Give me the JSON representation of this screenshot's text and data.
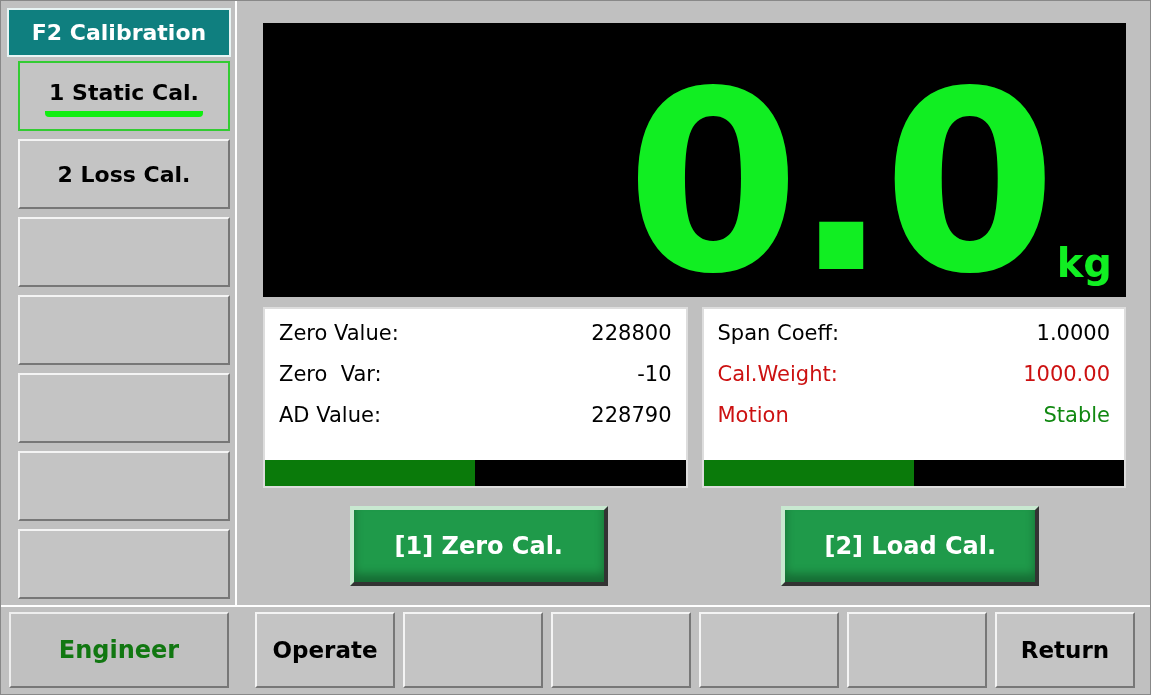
{
  "sidebar": {
    "title": "F2 Calibration",
    "items": [
      {
        "label": "1 Static Cal.",
        "selected": true
      },
      {
        "label": "2 Loss Cal.",
        "selected": false
      },
      {
        "selected": false
      },
      {
        "selected": false
      },
      {
        "selected": false
      },
      {
        "selected": false
      },
      {
        "selected": false
      }
    ]
  },
  "readout": {
    "value": "0.0",
    "unit": "kg"
  },
  "panels": [
    {
      "rows": [
        {
          "label": "Zero Value:",
          "value": "228800",
          "kind": "plain"
        },
        {
          "label": "Zero  Var:",
          "value": "-10",
          "kind": "plain"
        },
        {
          "label": "AD Value:",
          "value": "228790",
          "kind": "plain"
        }
      ],
      "level": 0.5
    },
    {
      "rows": [
        {
          "label": "Span Coeff:",
          "value": "1.0000",
          "kind": "plain"
        },
        {
          "label": "Cal.Weight:",
          "value": "1000.00",
          "kind": "setting"
        },
        {
          "label": "Motion",
          "value": "Stable",
          "kind": "status"
        }
      ],
      "level": 0.5
    }
  ],
  "actions": [
    "[1] Zero Cal.",
    "[2] Load Cal."
  ],
  "user": "Engineer",
  "bottom_buttons": [
    {
      "kind": "text",
      "label": "Operate"
    },
    {
      "kind": "blank"
    },
    {
      "kind": "blank"
    },
    {
      "kind": "blank"
    },
    {
      "kind": "blank"
    },
    {
      "kind": "text",
      "label": "Return"
    }
  ]
}
